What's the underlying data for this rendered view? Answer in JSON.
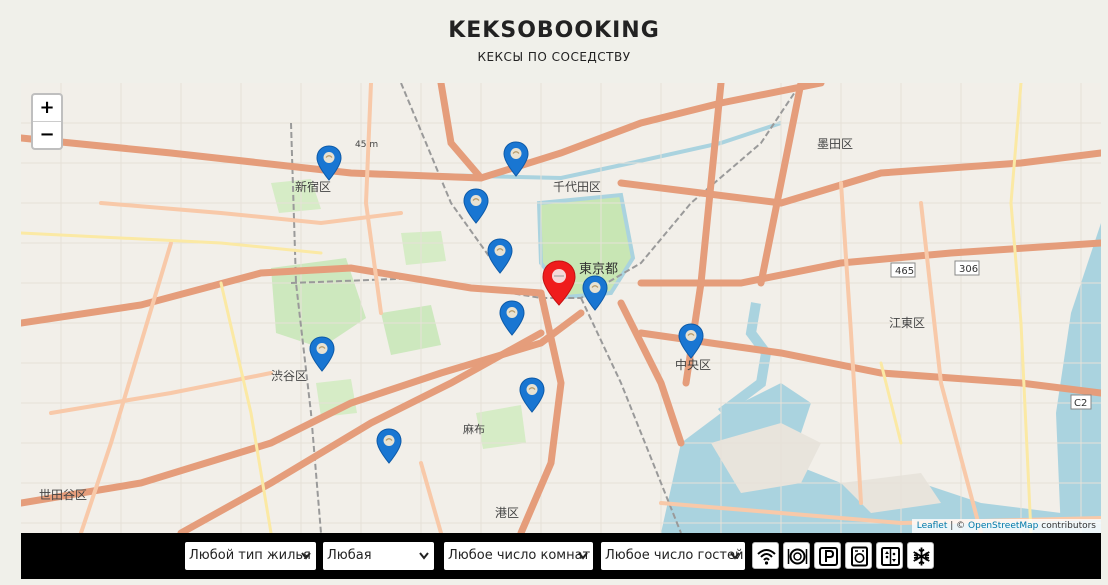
{
  "header": {
    "logo": "KEKSOBOOKING",
    "tagline": "КЕКСЫ ПО СОСЕДСТВУ"
  },
  "map": {
    "zoom_in": "+",
    "zoom_out": "−",
    "attribution": {
      "leaflet": "Leaflet",
      "separator": " | © ",
      "osm": "OpenStreetMap",
      "suffix": " contributors"
    },
    "place_labels": {
      "shinjuku": "新宿区",
      "chiyoda": "千代田区",
      "tokyo": "東京都",
      "sumida": "墨田区",
      "koto": "江東区",
      "chuo": "中央区",
      "shibuya": "渋谷区",
      "minato": "港区",
      "setagaya": "世田谷区",
      "azabu": "麻布",
      "route465": "465",
      "route306": "306",
      "c2": "C2",
      "elev": "45 m"
    }
  },
  "filters": {
    "type": "Любой тип жилья",
    "price": "Любая",
    "rooms": "Любое число комнат",
    "guests": "Любое число гостей",
    "features": [
      "wifi-icon",
      "dishwasher-icon",
      "parking-icon",
      "washer-icon",
      "elevator-icon",
      "conditioner-icon"
    ]
  },
  "colors": {
    "pin_blue": "#1976d2",
    "pin_main": "#ef1c1c",
    "filter_bar": "#000000"
  }
}
